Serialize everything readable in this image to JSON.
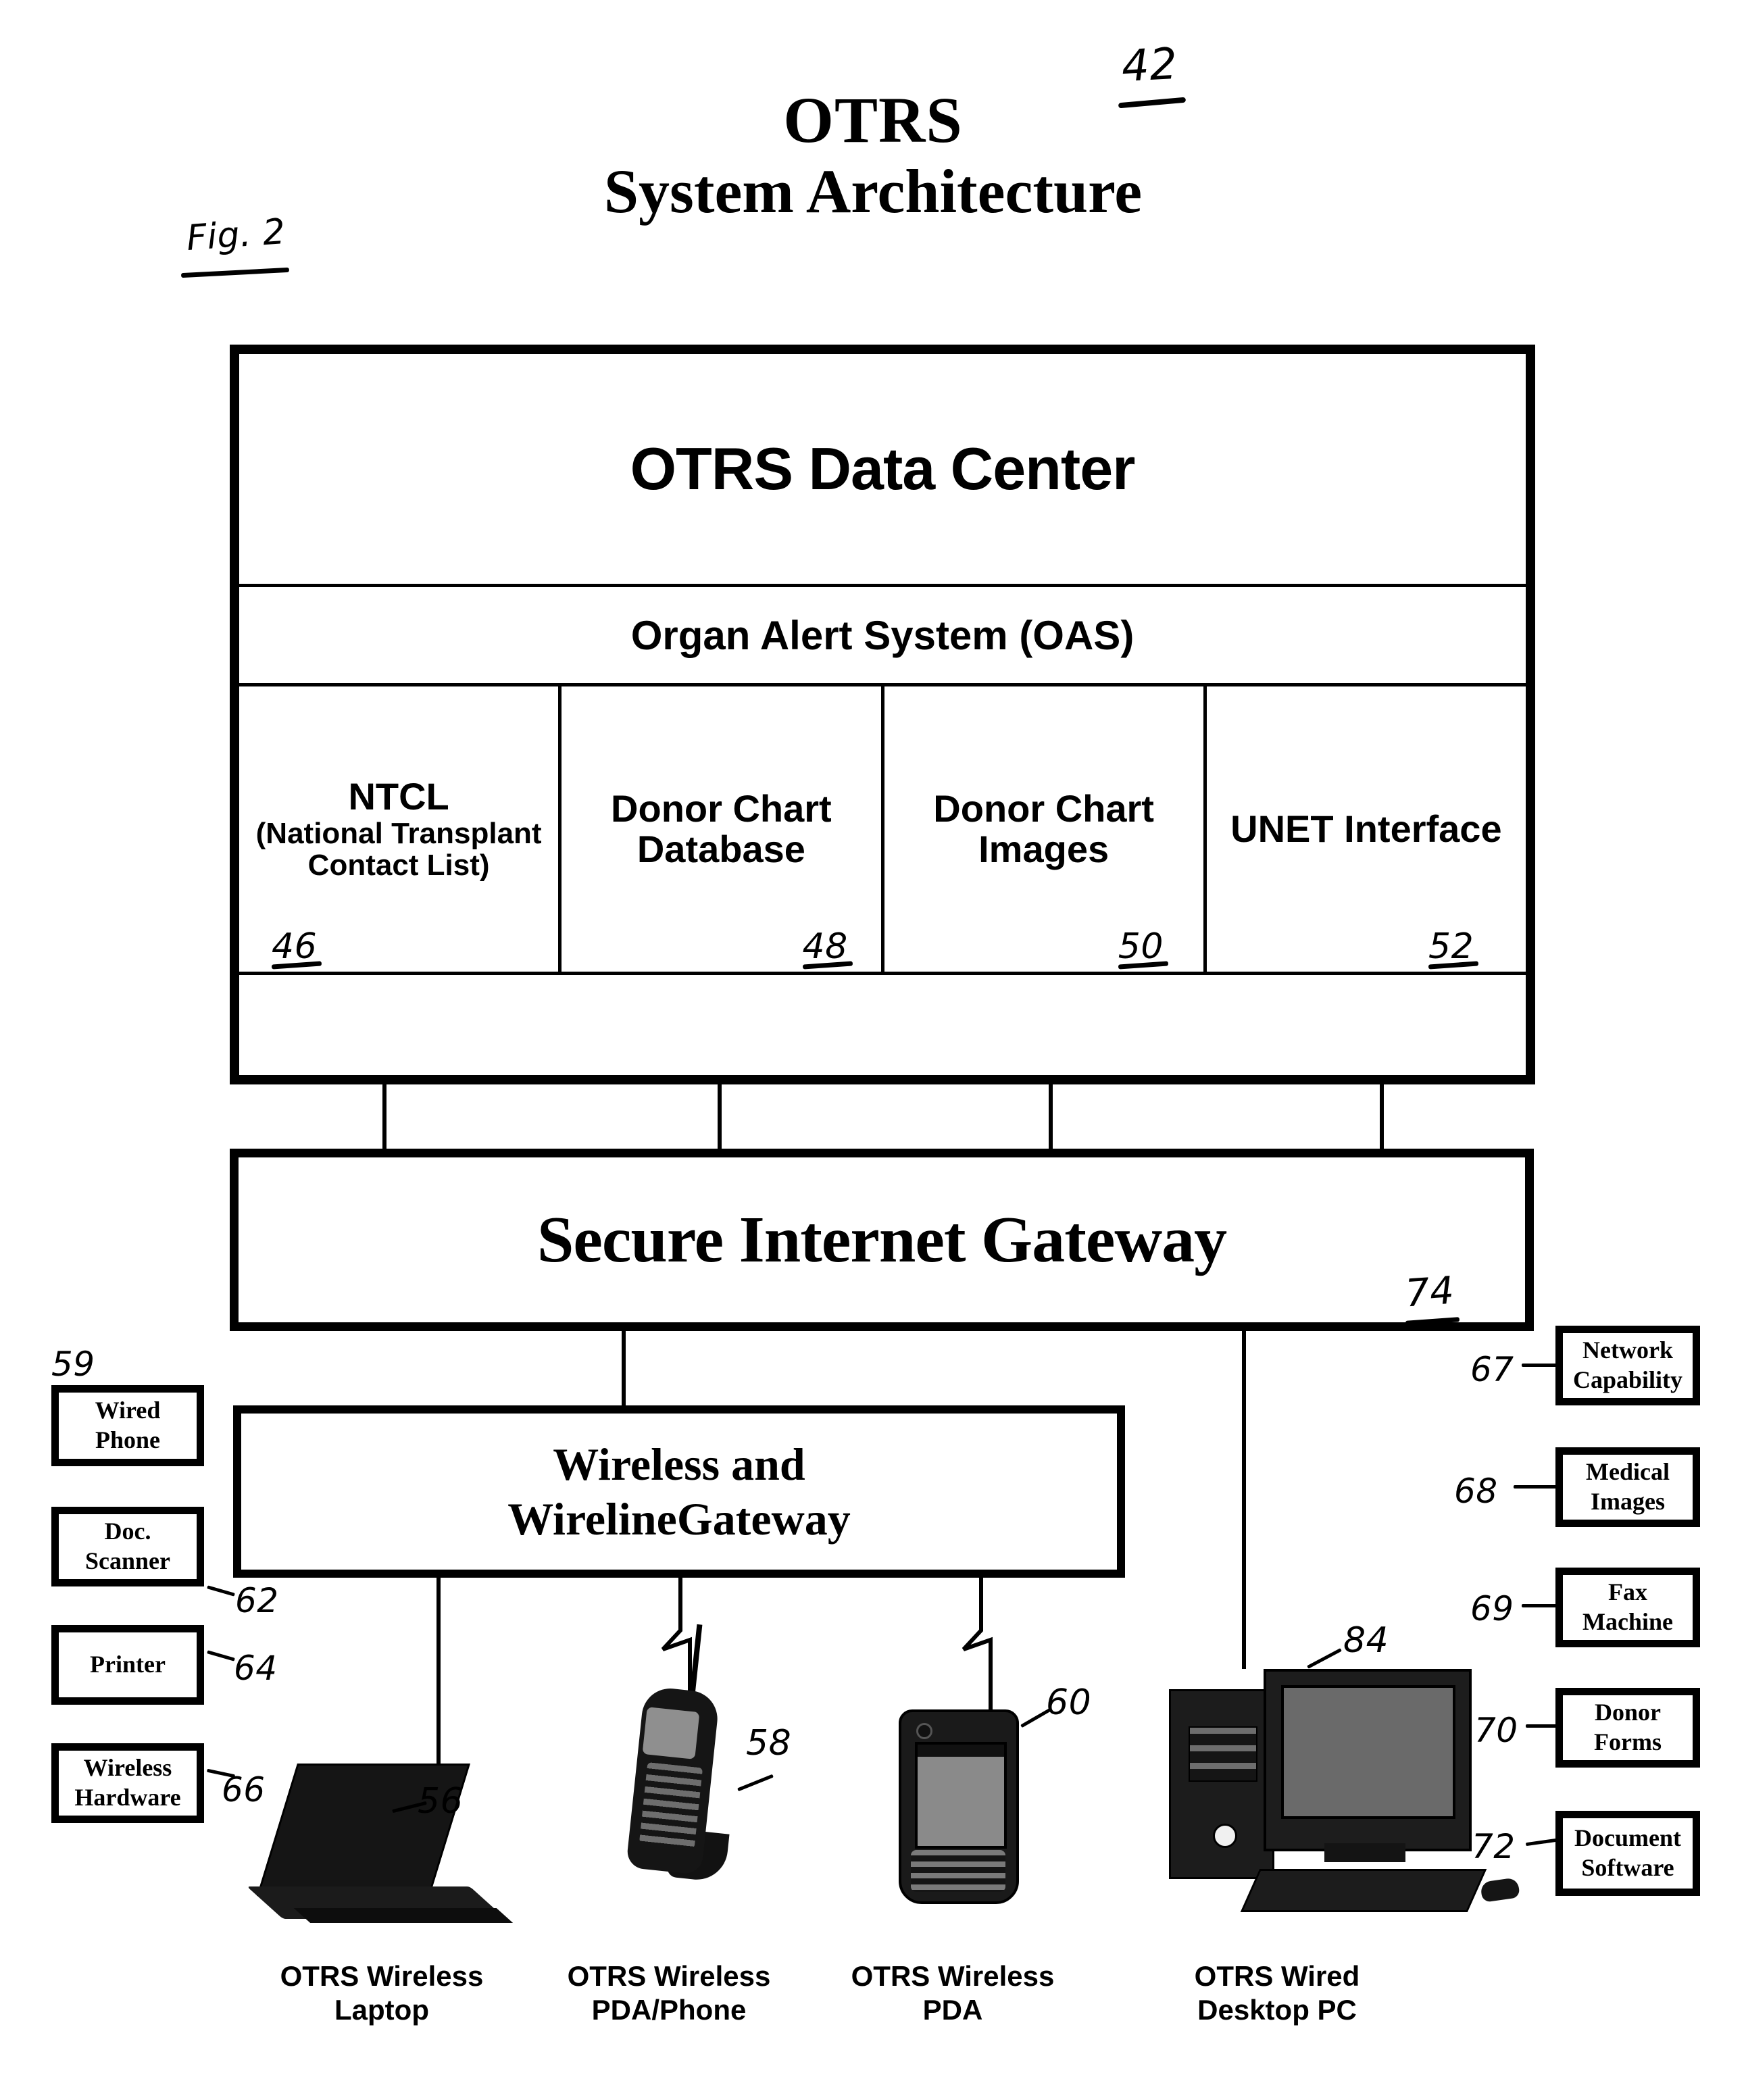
{
  "figure": {
    "label": "Fig. 2"
  },
  "title": {
    "line1": "OTRS",
    "line2": "System Architecture"
  },
  "data_center": {
    "title": "OTRS Data Center",
    "ref": "42",
    "oas_title": "Organ Alert System (OAS)",
    "cells": [
      {
        "label_main": "NTCL",
        "label_sub": "(National Transplant Contact List)",
        "ref": "46"
      },
      {
        "label_main": "Donor Chart Database",
        "label_sub": "",
        "ref": "48"
      },
      {
        "label_main": "Donor Chart Images",
        "label_sub": "",
        "ref": "50"
      },
      {
        "label_main": "UNET Interface",
        "label_sub": "",
        "ref": "52"
      }
    ]
  },
  "secure_gateway": {
    "title": "Secure Internet Gateway",
    "ref": "74"
  },
  "wireless_gateway": {
    "line1": "Wireless and",
    "line2": "WirelineGateway"
  },
  "left_peripherals": [
    {
      "label_line1": "Wired",
      "label_line2": "Phone",
      "ref": "59"
    },
    {
      "label_line1": "Doc.",
      "label_line2": "Scanner",
      "ref": "62"
    },
    {
      "label_line1": "Printer",
      "label_line2": "",
      "ref": "64"
    },
    {
      "label_line1": "Wireless",
      "label_line2": "Hardware",
      "ref": "66"
    }
  ],
  "right_peripherals": [
    {
      "label_line1": "Network",
      "label_line2": "Capability",
      "ref": "67"
    },
    {
      "label_line1": "Medical",
      "label_line2": "Images",
      "ref": "68"
    },
    {
      "label_line1": "Fax",
      "label_line2": "Machine",
      "ref": "69"
    },
    {
      "label_line1": "Donor",
      "label_line2": "Forms",
      "ref": "70"
    },
    {
      "label_line1": "Document",
      "label_line2": "Software",
      "ref": "72"
    }
  ],
  "devices": [
    {
      "caption_line1": "OTRS Wireless",
      "caption_line2": "Laptop",
      "ref": "56"
    },
    {
      "caption_line1": "OTRS Wireless",
      "caption_line2": "PDA/Phone",
      "ref": "58"
    },
    {
      "caption_line1": "OTRS Wireless",
      "caption_line2": "PDA",
      "ref": "60"
    },
    {
      "caption_line1": "OTRS Wired",
      "caption_line2": "Desktop PC",
      "ref": "84"
    }
  ]
}
